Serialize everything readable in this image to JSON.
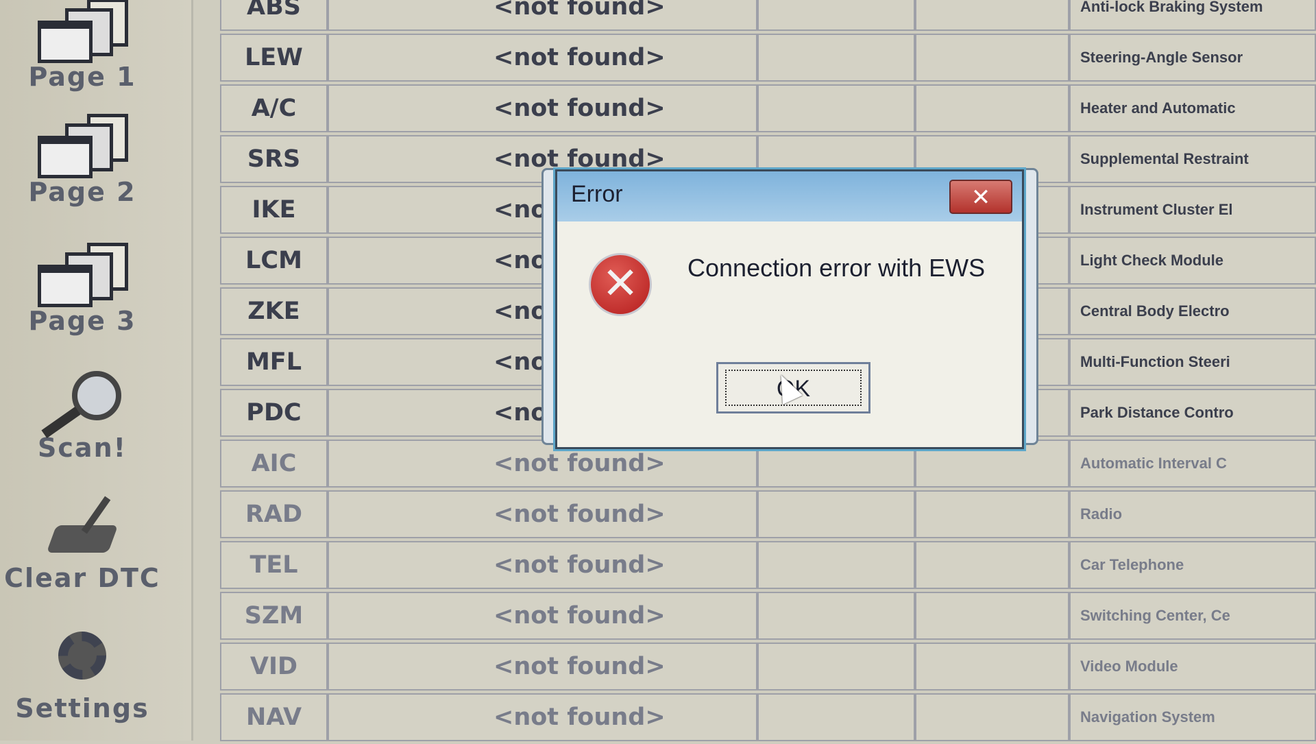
{
  "sidebar": {
    "items": [
      {
        "label": "Page 1",
        "icon": "windows-stack-icon"
      },
      {
        "label": "Page 2",
        "icon": "windows-stack-icon"
      },
      {
        "label": "Page 3",
        "icon": "windows-stack-icon"
      },
      {
        "label": "Scan!",
        "icon": "magnifier-icon"
      },
      {
        "label": "Clear DTC",
        "icon": "broom-icon"
      },
      {
        "label": "Settings",
        "icon": "gear-icon"
      }
    ]
  },
  "table": {
    "rows": [
      {
        "code": "ABS",
        "status": "<not found>",
        "description": "Anti-lock Braking System"
      },
      {
        "code": "LEW",
        "status": "<not found>",
        "description": "Steering-Angle Sensor"
      },
      {
        "code": "A/C",
        "status": "<not found>",
        "description": "Heater and Automatic"
      },
      {
        "code": "SRS",
        "status": "<not found>",
        "description": "Supplemental Restraint"
      },
      {
        "code": "IKE",
        "status": "<not found>",
        "description": "Instrument Cluster El"
      },
      {
        "code": "LCM",
        "status": "<not found>",
        "description": "Light Check Module"
      },
      {
        "code": "ZKE",
        "status": "<not found>",
        "description": "Central Body Electro"
      },
      {
        "code": "MFL",
        "status": "<not found>",
        "description": "Multi-Function Steeri"
      },
      {
        "code": "PDC",
        "status": "<not found>",
        "description": "Park Distance Contro"
      },
      {
        "code": "AIC",
        "status": "<not found>",
        "description": "Automatic Interval C"
      },
      {
        "code": "RAD",
        "status": "<not found>",
        "description": "Radio"
      },
      {
        "code": "TEL",
        "status": "<not found>",
        "description": "Car Telephone"
      },
      {
        "code": "SZM",
        "status": "<not found>",
        "description": "Switching Center, Ce"
      },
      {
        "code": "VID",
        "status": "<not found>",
        "description": "Video Module"
      },
      {
        "code": "NAV",
        "status": "<not found>",
        "description": "Navigation System"
      }
    ]
  },
  "dialog": {
    "title": "Error",
    "close_label": "✕",
    "icon": "error-x-icon",
    "message": "Connection error with EWS",
    "ok_label": "OK",
    "colors": {
      "title_bar": "#a9cde8",
      "close": "#b3322c",
      "error_icon": "#c4262a"
    }
  }
}
